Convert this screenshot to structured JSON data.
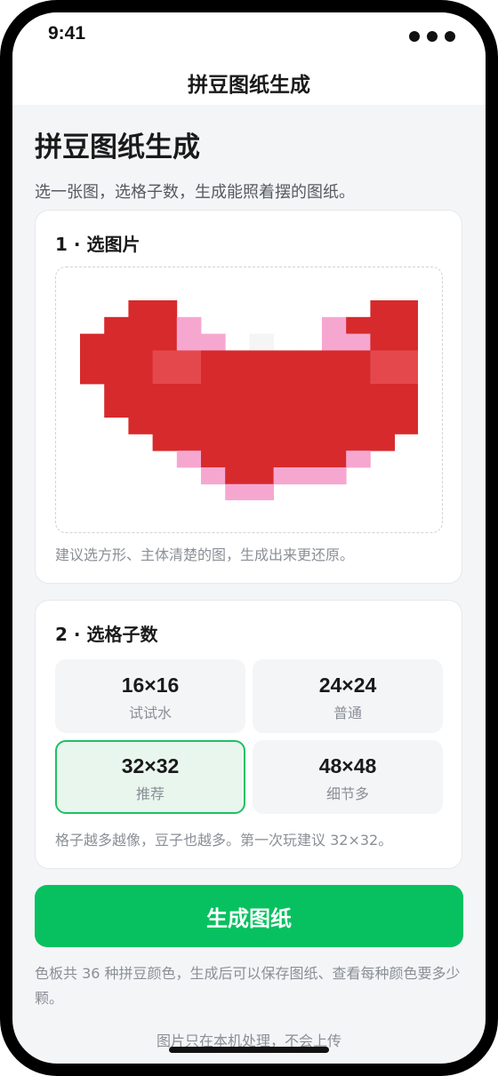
{
  "status_bar": {
    "time": "9:41"
  },
  "nav": {
    "title": "拼豆图纸生成"
  },
  "page": {
    "title": "拼豆图纸生成",
    "subtitle": "选一张图，选格子数，生成能照着摆的图纸。"
  },
  "step1": {
    "title": "1 · 选图片",
    "hint": "建议选方形、主体清楚的图，生成出来更还原。",
    "preview_image": "pixel-heart",
    "preview_colors": {
      "red": "#d72a2c",
      "light_red": "#e5484c",
      "pink": "#f6a7d0",
      "white": "#f5f5f5"
    }
  },
  "step2": {
    "title": "2 · 选格子数",
    "options": [
      {
        "size": "16×16",
        "desc": "试试水",
        "selected": false
      },
      {
        "size": "24×24",
        "desc": "普通",
        "selected": false
      },
      {
        "size": "32×32",
        "desc": "推荐",
        "selected": true
      },
      {
        "size": "48×48",
        "desc": "细节多",
        "selected": false
      }
    ],
    "hint": "格子越多越像，豆子也越多。第一次玩建议 32×32。"
  },
  "generate_button": {
    "label": "生成图纸",
    "color": "#07c160"
  },
  "palette_note": "色板共 36 种拼豆颜色，生成后可以保存图纸、查看每种颜色要多少颗。",
  "privacy_note": "图片只在本机处理，不会上传"
}
